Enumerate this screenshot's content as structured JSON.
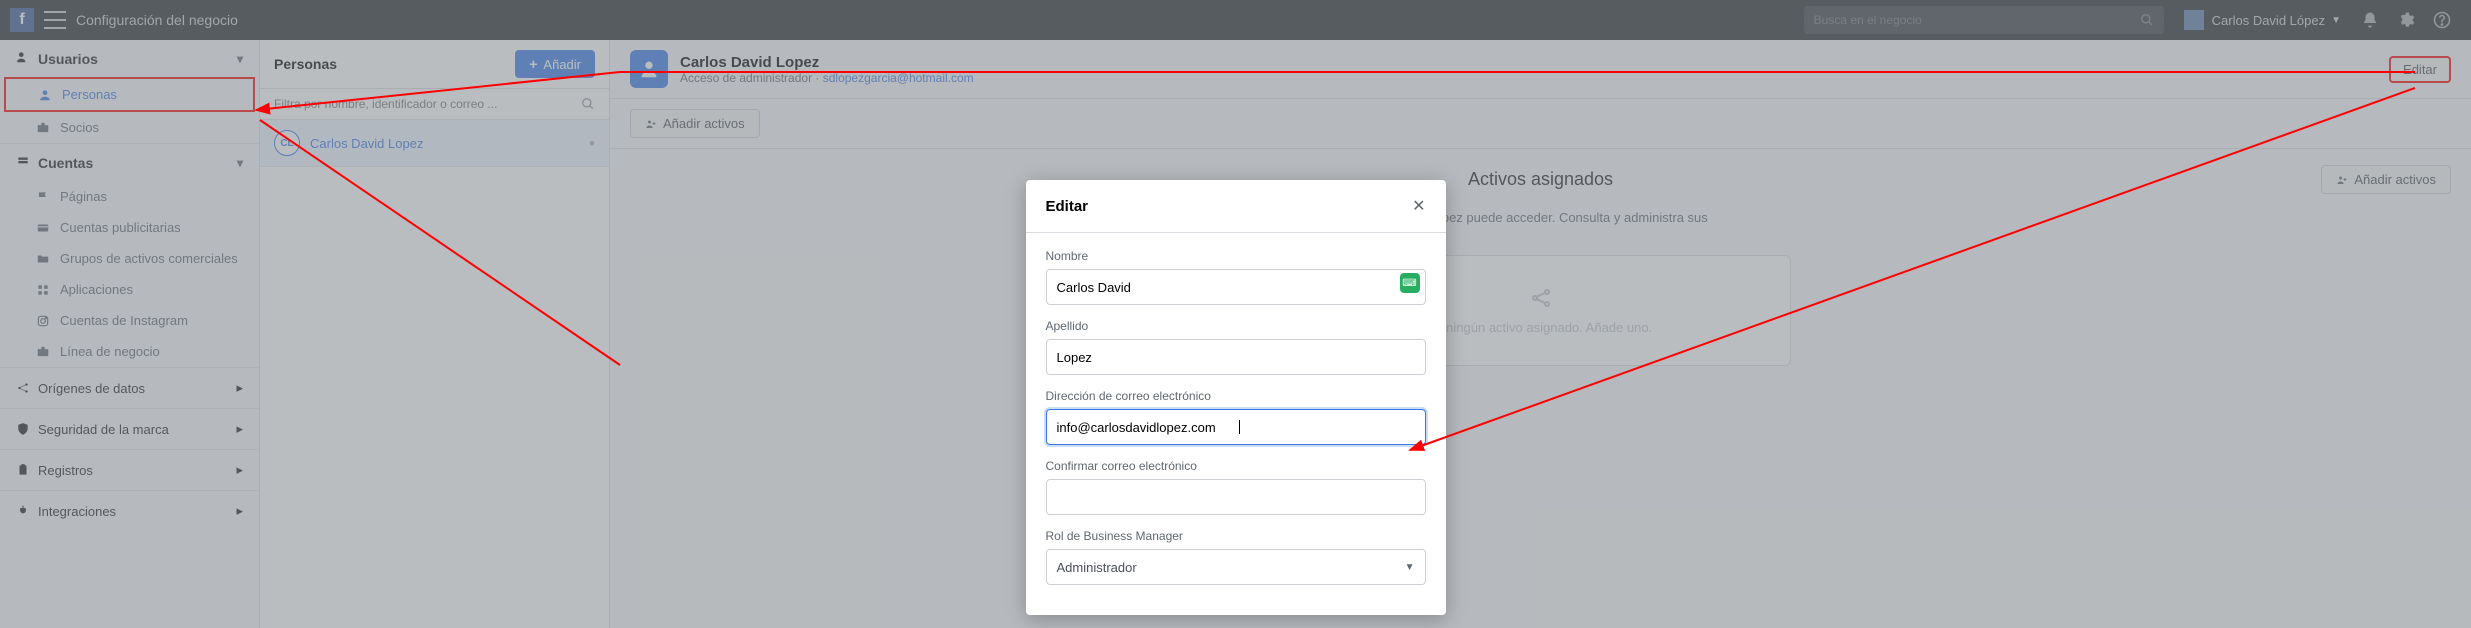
{
  "topbar": {
    "title": "Configuración del negocio",
    "search_placeholder": "Busca en el negocio",
    "user_name": "Carlos David López"
  },
  "sidebar": {
    "users": {
      "title": "Usuarios",
      "personas": "Personas",
      "socios": "Socios"
    },
    "accounts": {
      "title": "Cuentas",
      "paginas": "Páginas",
      "cuentas_pub": "Cuentas publicitarias",
      "grupos": "Grupos de activos comerciales",
      "aplicaciones": "Aplicaciones",
      "instagram": "Cuentas de Instagram",
      "linea": "Línea de negocio"
    },
    "origenes": "Orígenes de datos",
    "seguridad": "Seguridad de la marca",
    "registros": "Registros",
    "integraciones": "Integraciones"
  },
  "personas": {
    "title": "Personas",
    "add": "Añadir",
    "filter_placeholder": "Filtra por nombre, identificador o correo ...",
    "list": [
      {
        "initials": "CL",
        "name": "Carlos David Lopez"
      }
    ]
  },
  "detail": {
    "name": "Carlos David Lopez",
    "role": "Acceso de administrador · ",
    "email": "sdlopezgarcia@hotmail.com",
    "edit": "Editar",
    "add_assets": "Añadir activos",
    "assigned_title": "Activos asignados",
    "assigned_desc_1": "os David Lopez puede acceder. Consulta y administra sus",
    "empty": "ay ningún activo asignado. Añade uno."
  },
  "modal": {
    "title": "Editar",
    "nombre_label": "Nombre",
    "nombre_value": "Carlos David",
    "apellido_label": "Apellido",
    "apellido_value": "Lopez",
    "email_label": "Dirección de correo electrónico",
    "email_value": "info@carlosdavidlopez.com",
    "confirm_label": "Confirmar correo electrónico",
    "confirm_value": "",
    "rol_label": "Rol de Business Manager",
    "rol_value": "Administrador"
  }
}
